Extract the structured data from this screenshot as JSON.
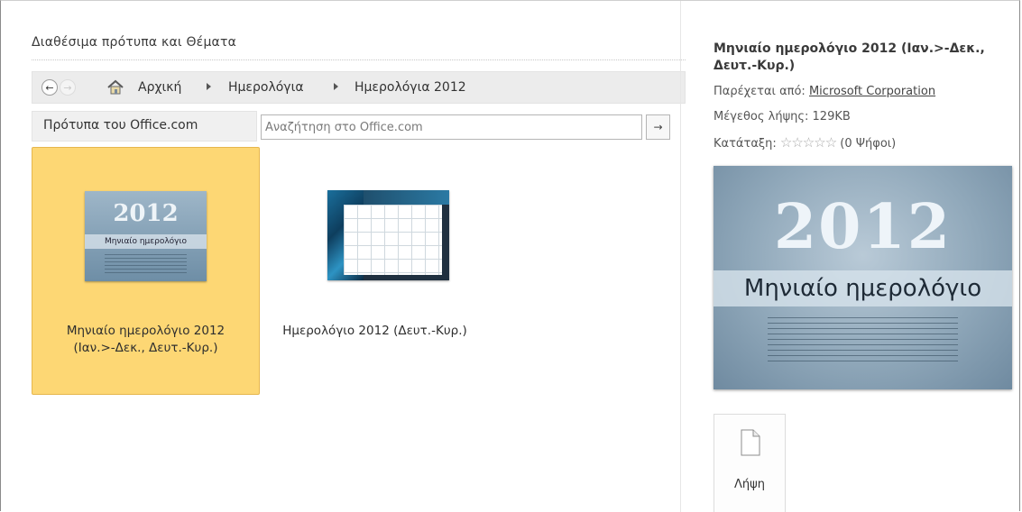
{
  "panel_title": "Διαθέσιμα πρότυπα και Θέματα",
  "nav": {
    "back_label": "←",
    "forward_label": "→",
    "breadcrumbs": [
      "Αρχική",
      "Ημερολόγια",
      "Ημερολόγια 2012"
    ]
  },
  "source_tab_label": "Πρότυπα του Office.com",
  "search": {
    "placeholder": "Αναζήτηση στο Office.com",
    "value": "",
    "button_label": "→"
  },
  "templates": [
    {
      "label_line1": "Μηνιαίο ημερολόγιο 2012",
      "label_line2": "(Ιαν.>-Δεκ., Δευτ.-Κυρ.)",
      "selected": true,
      "thumb_year": "2012",
      "thumb_subtitle": "Μηνιαίο ημερολόγιο"
    },
    {
      "label_line1": "Ημερολόγιο 2012 (Δευτ.-Κυρ.)",
      "selected": false
    }
  ],
  "details": {
    "title": "Μηνιαίο ημερολόγιο 2012 (Ιαν.>-Δεκ., Δευτ.-Κυρ.)",
    "provided_by_label": "Παρέχεται από:",
    "provider": "Microsoft Corporation",
    "download_size": "Μέγεθος λήψης: 129KB",
    "rating_label": "Κατάταξη:",
    "rating_stars": "☆☆☆☆☆",
    "votes": "(0 Ψήφοι)",
    "preview_year": "2012",
    "preview_subtitle": "Μηνιαίο ημερολόγιο",
    "download_label": "Λήψη"
  },
  "colors": {
    "selected_tile_bg": "#fdd774",
    "selected_tile_border": "#e6b64d",
    "nav_bar_bg": "#ececec"
  },
  "icons": [
    "back-arrow-icon",
    "forward-arrow-icon",
    "home-icon",
    "breadcrumb-arrow-icon",
    "search-arrow-icon",
    "star-icon",
    "document-icon"
  ]
}
